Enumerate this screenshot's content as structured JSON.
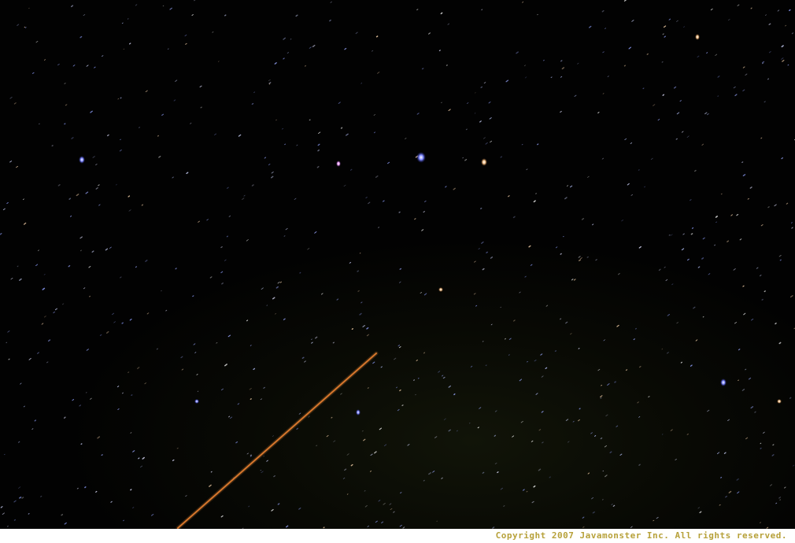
{
  "photo": {
    "subject": "night-sky-star-trail",
    "colors": {
      "sky": "#020202",
      "trail": "#d8742a",
      "bright_star_blue": "#6f7cff",
      "bright_star_warm": "#f0c080"
    }
  },
  "footer": {
    "copyright": "Copyright 2007 Javamonster Inc. All rights reserved."
  }
}
